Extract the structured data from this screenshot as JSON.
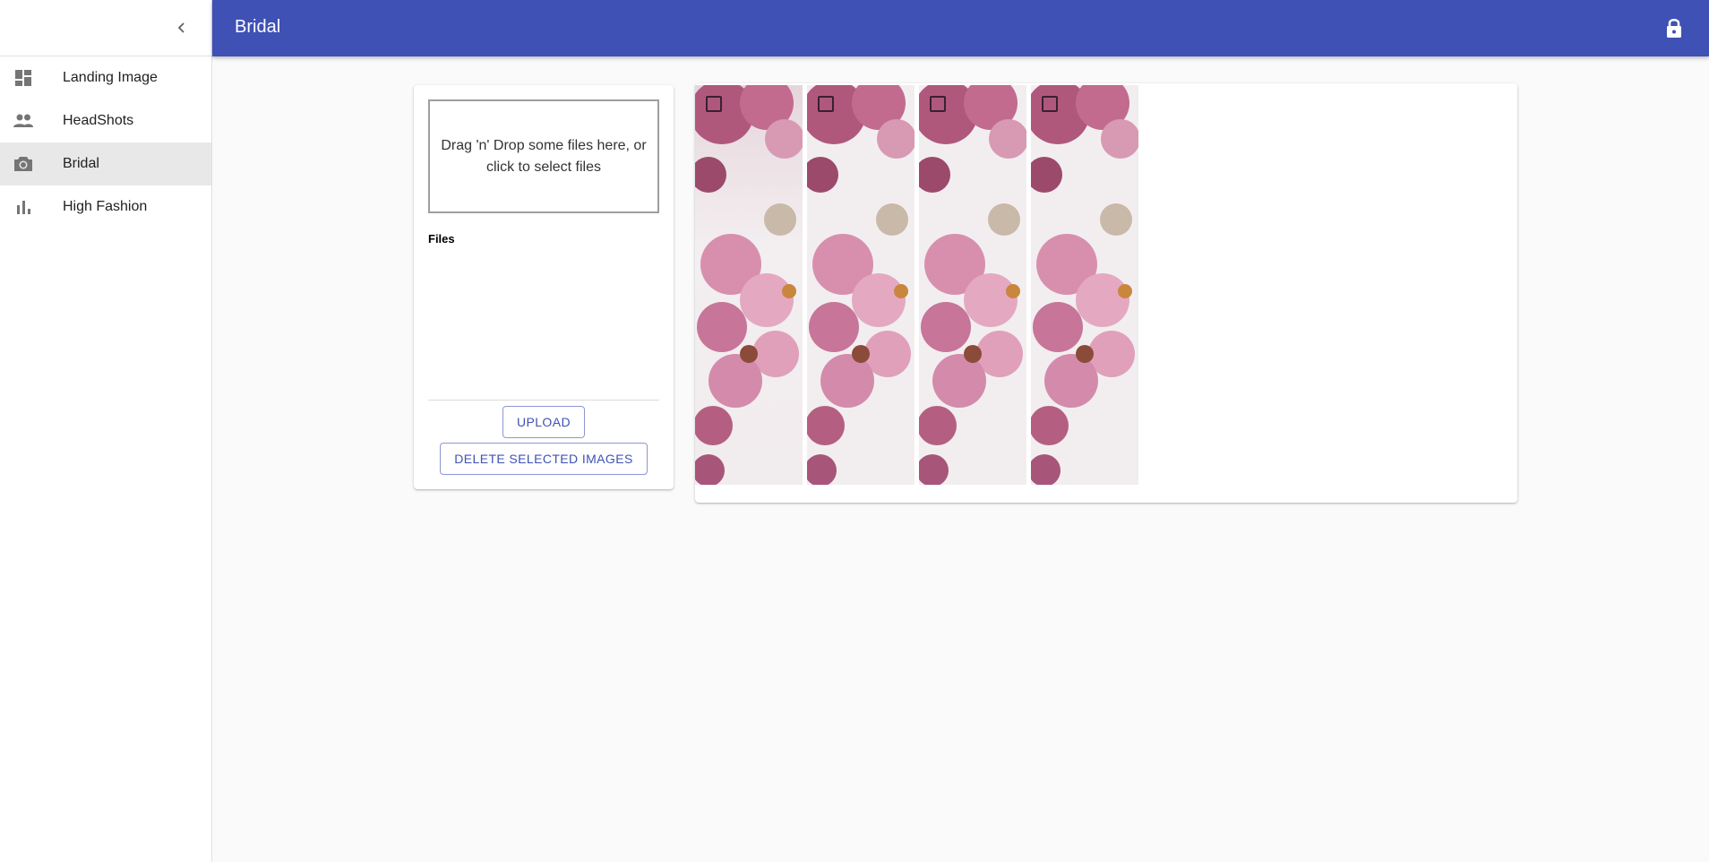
{
  "sidebar": {
    "collapse_icon": "chevron-left-icon",
    "items": [
      {
        "label": "Landing Image",
        "icon": "dashboard-icon",
        "active": false
      },
      {
        "label": "HeadShots",
        "icon": "people-icon",
        "active": false
      },
      {
        "label": "Bridal",
        "icon": "camera-icon",
        "active": true
      },
      {
        "label": "High Fashion",
        "icon": "bar-chart-icon",
        "active": false
      }
    ]
  },
  "header": {
    "title": "Bridal",
    "lock_icon": "lock-icon"
  },
  "upload": {
    "dropzone_text": "Drag 'n' Drop some files here, or click to select files",
    "files_label": "Files",
    "upload_label": "UPLOAD",
    "delete_label": "DELETE SELECTED IMAGES"
  },
  "gallery": {
    "images": [
      {
        "alt": "pink blossom photo",
        "checked": false
      },
      {
        "alt": "pink blossom photo",
        "checked": false
      },
      {
        "alt": "pink blossom photo",
        "checked": false
      },
      {
        "alt": "pink blossom photo",
        "checked": false
      }
    ]
  },
  "colors": {
    "primary": "#3f51b5",
    "background": "#fafafa",
    "active_nav": "#e8e8e8"
  }
}
